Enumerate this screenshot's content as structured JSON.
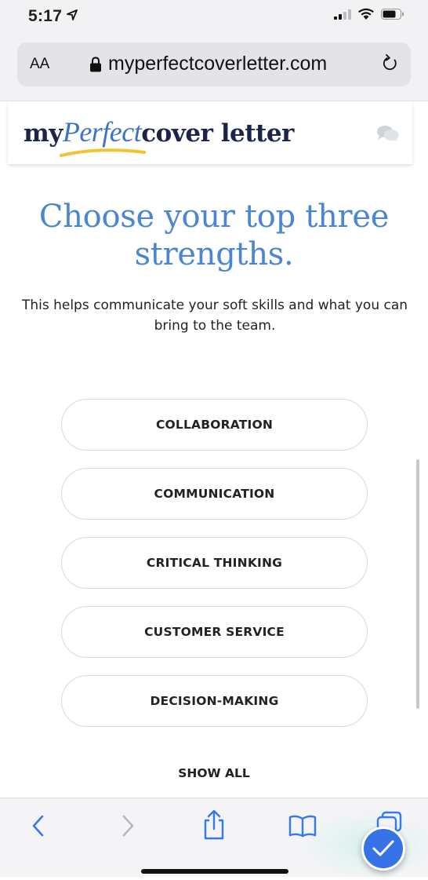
{
  "status_bar": {
    "time": "5:17"
  },
  "browser": {
    "aa_label": "AA",
    "url": "myperfectcoverletter.com"
  },
  "site": {
    "logo": {
      "my": "my",
      "perfect": "Perfect",
      "rest": "cover letter"
    }
  },
  "main": {
    "heading": "Choose your top three strengths.",
    "subheading": "This helps communicate your soft skills and what you can bring to the team.",
    "options": [
      "COLLABORATION",
      "COMMUNICATION",
      "CRITICAL THINKING",
      "CUSTOMER SERVICE",
      "DECISION-MAKING"
    ],
    "show_all": "SHOW ALL"
  },
  "colors": {
    "accent": "#4a86d1",
    "brand_navy": "#1c2449",
    "fab": "#3573e6"
  },
  "toolbar": {
    "icons": [
      "back-icon",
      "forward-icon",
      "share-icon",
      "bookmarks-icon",
      "tabs-icon"
    ]
  }
}
